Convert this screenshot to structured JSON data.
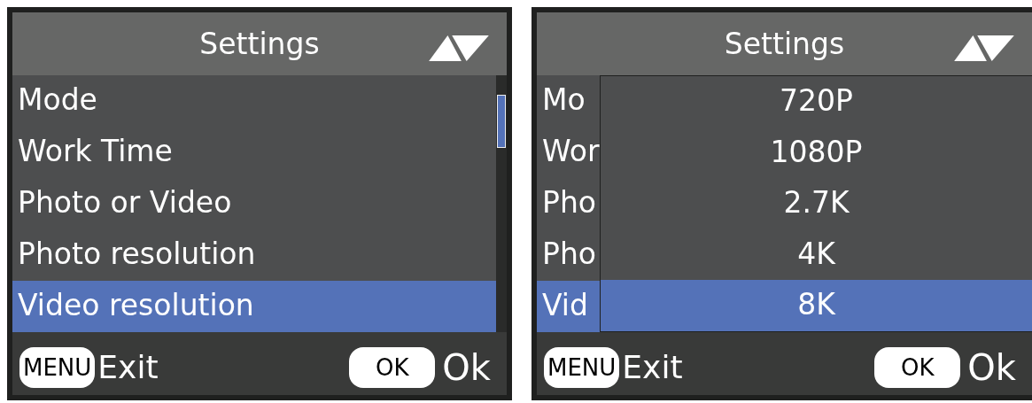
{
  "screens": [
    {
      "title": "Settings",
      "menu_items": [
        {
          "label": "Mode",
          "selected": false
        },
        {
          "label": "Work Time",
          "selected": false
        },
        {
          "label": "Photo or Video",
          "selected": false
        },
        {
          "label": "Photo resolution",
          "selected": false
        },
        {
          "label": "Video resolution",
          "selected": true
        }
      ],
      "footer": {
        "menu_key": "MENU",
        "menu_action": "Exit",
        "ok_key": "OK",
        "ok_action": "Ok"
      }
    },
    {
      "title": "Settings",
      "menu_items": [
        {
          "label": "Mo",
          "selected": false
        },
        {
          "label": "Wor",
          "selected": false
        },
        {
          "label": "Pho",
          "selected": false
        },
        {
          "label": "Pho",
          "selected": false
        },
        {
          "label": "Vid",
          "selected": true
        }
      ],
      "popup": {
        "options": [
          {
            "label": "720P",
            "selected": false
          },
          {
            "label": "1080P",
            "selected": false
          },
          {
            "label": "2.7K",
            "selected": false
          },
          {
            "label": "4K",
            "selected": false
          },
          {
            "label": "8K",
            "selected": true
          }
        ]
      },
      "footer": {
        "menu_key": "MENU",
        "menu_action": "Exit",
        "ok_key": "OK",
        "ok_action": "Ok"
      }
    }
  ]
}
